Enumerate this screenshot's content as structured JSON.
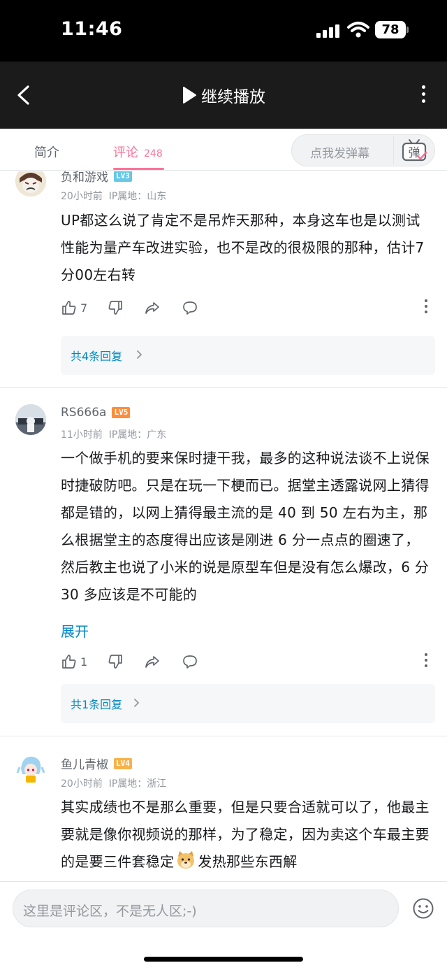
{
  "status_bar": {
    "time": "11:46",
    "battery": "78"
  },
  "navbar": {
    "title": "继续播放"
  },
  "tabs": {
    "intro_label": "简介",
    "comments_label": "评论",
    "comments_count": "248",
    "danmaku_placeholder": "点我发弹幕",
    "danmaku_icon_text": "弹"
  },
  "comments": [
    {
      "username": "负和游戏",
      "level": "LV3",
      "level_color": "#67c8e6",
      "time": "20小时前",
      "ip": "IP属地：山东",
      "text": "UP都这么说了肯定不是吊炸天那种，本身这车也是以测试性能为量产车改进实验，也不是改的很极限的那种，估计7分00左右转",
      "likes": "7",
      "replies_label": "共4条回复"
    },
    {
      "username": "RS666a",
      "level": "LV5",
      "level_color": "#ff8c3a",
      "time": "11小时前",
      "ip": "IP属地：广东",
      "text": "一个做手机的要来保时捷干我，最多的这种说法谈不上说保时捷破防吧。只是在玩一下梗而已。据堂主透露说网上猜得都是错的，以网上猜得最主流的是 40 到 50 左右为主，那么根据堂主的态度得出应该是刚进 6 分一点点的圈速了，然后教主也说了小米的说是原型车但是没有怎么爆改，6 分 30 多应该是不可能的",
      "expand_label": "展开",
      "likes": "1",
      "replies_label": "共1条回复"
    },
    {
      "username": "鱼儿青椒",
      "level": "LV4",
      "level_color": "#f6b34b",
      "time": "20小时前",
      "ip": "IP属地：浙江",
      "text_before_emoji": "其实成绩也不是那么重要，但是只要合适就可以了，他最主要就是像你视频说的那样，为了稳定，因为卖这个车最主要的是要三件套稳定",
      "text_after_emoji": "发热那些东西解"
    }
  ],
  "input": {
    "placeholder": "这里是评论区，不是无人区;-)"
  },
  "colors": {
    "accent": "#fb7299",
    "link": "#008ac5"
  }
}
